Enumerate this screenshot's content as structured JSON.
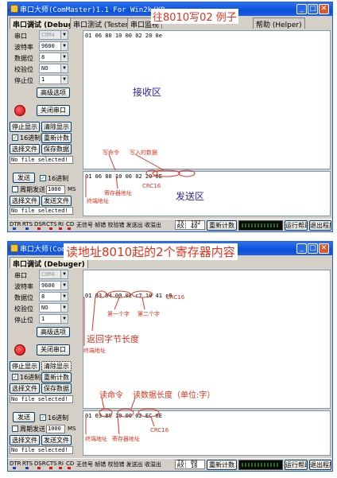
{
  "windows": [
    {
      "title": "串口大师(ComMaster)1.1 For Win2k/XP",
      "annotation_title": "往8010写02 例子",
      "tabs": [
        "串口调试 (Debuger)",
        "串口测试 (Tester)",
        "串口监视",
        "帮助 (Helper)"
      ],
      "settings": [
        {
          "label": "串口",
          "value": "COM4",
          "disabled": true
        },
        {
          "label": "波特率",
          "value": "9600",
          "disabled": false
        },
        {
          "label": "数据位",
          "value": "8",
          "disabled": false
        },
        {
          "label": "校验位",
          "value": "NO",
          "disabled": false
        },
        {
          "label": "停止位",
          "value": "1",
          "disabled": false
        }
      ],
      "advanced_btn": "高级选项",
      "close_port_btn": "关闭串口",
      "stop_display_btn": "停止显示",
      "clear_display_btn": "清除显示",
      "hex16_label": "16进制",
      "recount_btn": "重新计数",
      "select_file_btn": "选择文件",
      "save_data_btn": "保存数据",
      "recv_status": "No file selected!",
      "send_btn": "发送",
      "send_hex_label": "16进制",
      "periodic_label": "周期发送",
      "period_value": "1000",
      "period_unit": "MS",
      "send_file_btn": "发送文件",
      "send_status": "No file selected!",
      "recv_text": "01 06 80 10 00 02 20 0e",
      "recv_zone": "接收区",
      "send_text": "01 06 80 10 00 02 20 0E",
      "send_zone": "发送区",
      "annotations": {
        "write_cmd": "写命令",
        "write_data": "写入的数据",
        "slave_addr": "终端地址",
        "reg_addr": "寄存器地址",
        "crc": "CRC16"
      },
      "bottom": {
        "signals": [
          "DTR",
          "RTS",
          "DSR",
          "CTS",
          "RI",
          "CD"
        ],
        "status": "无信号 帧错 校验错 发送出 收溢出",
        "tx": "TX: 192",
        "rx": "RX: 40",
        "recount": "重新计数",
        "run_help": "运行帮助",
        "exit": "退出程序"
      }
    },
    {
      "title": "串口大师(ComMaster)1.1 For Win2k/XP",
      "annotation_title": "读地址8010起的2个寄存器内容",
      "tabs": [
        "串口调试 (Debuger)"
      ],
      "settings": [
        {
          "label": "串口",
          "value": "COM4",
          "disabled": true
        },
        {
          "label": "波特率",
          "value": "9600",
          "disabled": false
        },
        {
          "label": "数据位",
          "value": "8",
          "disabled": false
        },
        {
          "label": "校验位",
          "value": "NO",
          "disabled": false
        },
        {
          "label": "停止位",
          "value": "1",
          "disabled": false
        }
      ],
      "advanced_btn": "高级选项",
      "close_port_btn": "关闭串口",
      "stop_display_btn": "停止显示",
      "clear_display_btn": "清除显示",
      "hex16_label": "16进制",
      "recount_btn": "重新计数",
      "select_file_btn": "选择文件",
      "save_data_btn": "保存数据",
      "recv_status": "No file selected!",
      "send_btn": "发送",
      "send_hex_label": "16进制",
      "periodic_label": "周期发送",
      "period_value": "1000",
      "period_unit": "MS",
      "send_file_btn": "发送文件",
      "send_status": "No file selected!",
      "recv_text": "01 03 04 00 02 c7 10 41 c8",
      "send_text": "01 03 80 10 00 02 EC 0E",
      "annotations": {
        "crc_recv": "CRC16",
        "first_word": "第一个字",
        "second_word": "第二个字",
        "return_len": "返回字节长度",
        "slave_addr_r": "终端地址",
        "read_cmd": "读命令",
        "read_len": "读数据长度（单位:字）",
        "slave_addr": "终端地址",
        "reg_addr": "寄存器地址",
        "crc_send": "CRC16"
      },
      "bottom": {
        "signals": [
          "DTR",
          "RTS",
          "DSR",
          "CTS",
          "RI",
          "CD"
        ],
        "status": "无信号 帧错 校验错 发送出 收溢出",
        "tx": "TX: 80",
        "rx": "RX: 18",
        "recount": "重新计数",
        "run_help": "运行帮助",
        "exit": "退出程序"
      }
    }
  ]
}
